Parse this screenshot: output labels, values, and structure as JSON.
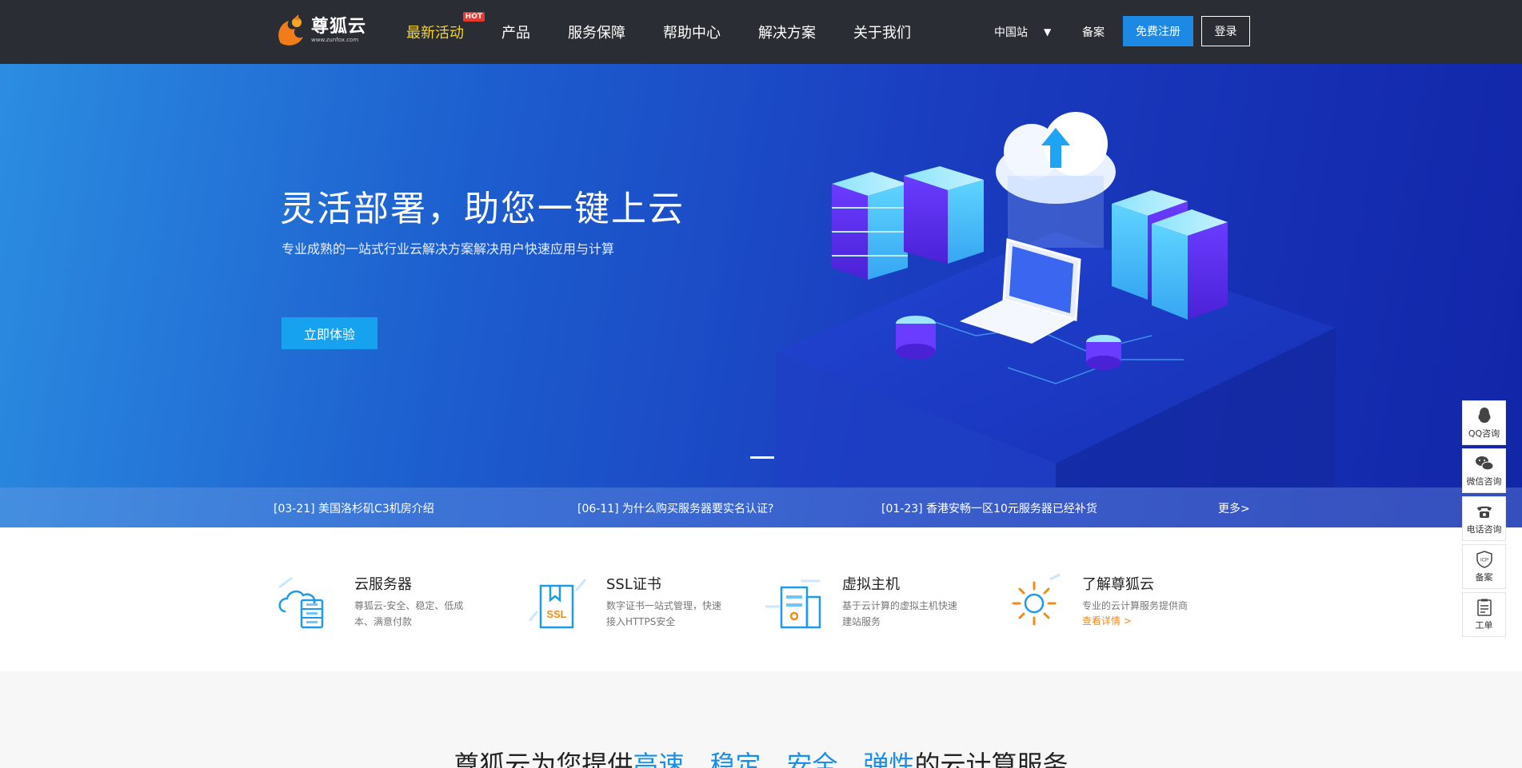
{
  "header": {
    "logo": {
      "name": "尊狐云",
      "url": "www.zunfox.com"
    },
    "nav": [
      {
        "label": "最新活动",
        "active": true,
        "badge": "HOT"
      },
      {
        "label": "产品"
      },
      {
        "label": "服务保障"
      },
      {
        "label": "帮助中心"
      },
      {
        "label": "解决方案"
      },
      {
        "label": "关于我们"
      }
    ],
    "region": "中国站",
    "beian": "备案",
    "register": "免费注册",
    "login": "登录"
  },
  "banner": {
    "title": "灵活部署，助您一键上云",
    "subtitle": "专业成熟的一站式行业云解决方案解决用户快速应用与计算",
    "cta": "立即体验"
  },
  "news": {
    "items": [
      "[03-21] 美国洛杉矶C3机房介绍",
      "[06-11] 为什么购买服务器要实名认证?",
      "[01-23] 香港安畅一区10元服务器已经补货"
    ],
    "more": "更多>"
  },
  "features": [
    {
      "title": "云服务器",
      "desc": "尊狐云-安全、稳定、低成本、满意付款",
      "icon": "cloud-server-icon"
    },
    {
      "title": "SSL证书",
      "desc": "数字证书一站式管理，快速接入HTTPS安全",
      "icon": "ssl-certificate-icon"
    },
    {
      "title": "虚拟主机",
      "desc": "基于云计算的虚拟主机快速建站服务",
      "icon": "virtual-host-icon"
    },
    {
      "title": "了解尊狐云",
      "desc": "专业的云计算服务提供商",
      "link": "查看详情 >",
      "icon": "sun-gear-icon"
    }
  ],
  "bottom": {
    "prefix": "尊狐云为您提供",
    "h1": "高速",
    "sep1": "、",
    "h2": "稳定",
    "sep2": "、",
    "h3": "安全",
    "sep3": "、",
    "h4": "弹性",
    "suffix": "的云计算服务"
  },
  "sidebar": [
    {
      "label": "QQ咨询",
      "icon": "qq-icon"
    },
    {
      "label": "微信咨询",
      "icon": "wechat-icon"
    },
    {
      "label": "电话咨询",
      "icon": "phone-icon"
    },
    {
      "label": "备案",
      "icon": "icp-shield-icon"
    },
    {
      "label": "工单",
      "icon": "ticket-icon"
    }
  ],
  "colors": {
    "header_bg": "#2a2d33",
    "accent": "#1e88e5",
    "active_nav": "#f5d52a",
    "link_orange": "#f08c1a"
  }
}
